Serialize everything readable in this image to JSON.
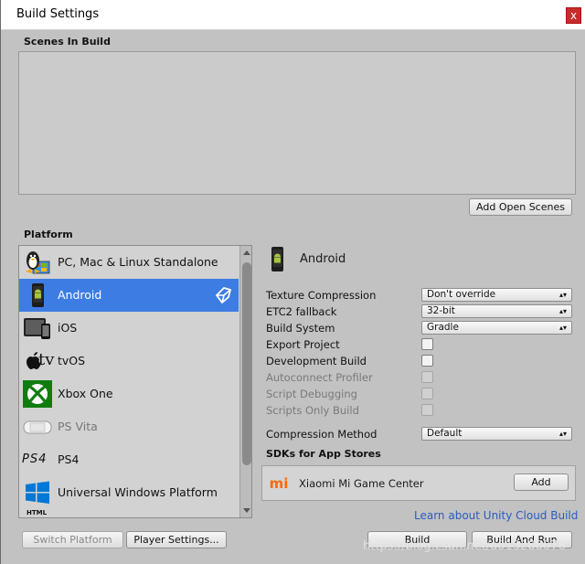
{
  "window": {
    "title": "Build Settings",
    "close_glyph": "x"
  },
  "scenes": {
    "label": "Scenes In Build",
    "add_open_scenes": "Add Open Scenes"
  },
  "platform": {
    "label": "Platform",
    "items": [
      {
        "label": "PC, Mac & Linux Standalone",
        "icon": "pc-mac-linux-icon",
        "selected": false,
        "dim": false
      },
      {
        "label": "Android",
        "icon": "android-icon",
        "selected": true,
        "dim": false
      },
      {
        "label": "iOS",
        "icon": "ios-icon",
        "selected": false,
        "dim": false
      },
      {
        "label": "tvOS",
        "icon": "tvos-icon",
        "selected": false,
        "dim": false
      },
      {
        "label": "Xbox One",
        "icon": "xbox-icon",
        "selected": false,
        "dim": false
      },
      {
        "label": "PS Vita",
        "icon": "psvita-icon",
        "selected": false,
        "dim": true
      },
      {
        "label": "PS4",
        "icon": "ps4-icon",
        "selected": false,
        "dim": false
      },
      {
        "label": "Universal Windows Platform",
        "icon": "windows-icon",
        "selected": false,
        "dim": false
      },
      {
        "label": "",
        "icon": "html5-icon",
        "selected": false,
        "dim": false
      }
    ],
    "html_icon_text": "HTML",
    "ps4_logo_text": "PS4",
    "tv_text": "tv"
  },
  "android": {
    "header": "Android",
    "texture_compression": {
      "label": "Texture Compression",
      "value": "Don't override"
    },
    "etc2_fallback": {
      "label": "ETC2 fallback",
      "value": "32-bit"
    },
    "build_system": {
      "label": "Build System",
      "value": "Gradle"
    },
    "export_project": {
      "label": "Export Project"
    },
    "development_build": {
      "label": "Development Build"
    },
    "autoconnect_profiler": {
      "label": "Autoconnect Profiler"
    },
    "script_debugging": {
      "label": "Script Debugging"
    },
    "scripts_only_build": {
      "label": "Scripts Only Build"
    },
    "compression_method": {
      "label": "Compression Method",
      "value": "Default"
    }
  },
  "sdks": {
    "label": "SDKs for App Stores",
    "item": "Xiaomi Mi Game Center",
    "logo_text": "mi",
    "add": "Add"
  },
  "links": {
    "cloud_build": "Learn about Unity Cloud Build"
  },
  "footer": {
    "switch_platform": "Switch Platform",
    "player_settings": "Player Settings...",
    "build": "Build",
    "build_and_run": "Build And Run"
  },
  "watermark": "https://blog.csdn.net/u013288076",
  "colors": {
    "selection": "#3d7ce3",
    "panel": "#c2c2c2",
    "xbox": "#107c10",
    "windows": "#0078d7",
    "mi": "#ff6700"
  }
}
